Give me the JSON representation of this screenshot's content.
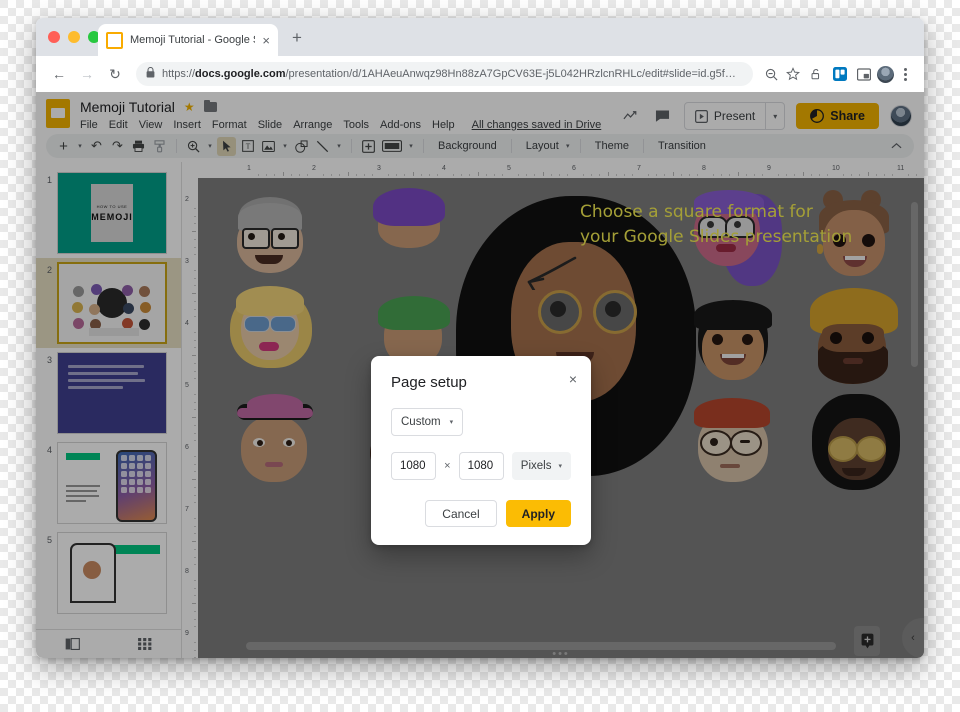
{
  "browser": {
    "tab": {
      "title": "Memoji Tutorial - Google Slides",
      "close_label": "×",
      "favicon_name": "slides-favicon"
    },
    "new_tab_label": "+",
    "nav": {
      "back": "←",
      "forward": "→",
      "reload": "↻"
    },
    "omnibox": {
      "url_scheme": "https://",
      "url_domain": "docs.google.com",
      "url_path": "/presentation/d/1AHAeuAnwqz98Hn88zA7GpCV63E-j5L042HRzlcnRHLc/edit#slide=id.g5f…",
      "lock_icon": "lock-icon",
      "zoom_out_icon": "zoom-out-icon",
      "bookmark_icon": "star-icon"
    },
    "extensions": [
      "open-lock-icon",
      "trello-icon",
      "pip-icon"
    ],
    "profile_icon": "profile-avatar",
    "menu_icon": "kebab-menu-icon"
  },
  "slides_app": {
    "doc_title": "Memoji Tutorial",
    "star_icon": "★",
    "folder_icon": "folder-icon",
    "menus": [
      "File",
      "Edit",
      "View",
      "Insert",
      "Format",
      "Slide",
      "Arrange",
      "Tools",
      "Add-ons",
      "Help"
    ],
    "save_status": "All changes saved in Drive",
    "header_actions": {
      "activity_icon": "activity-chart-icon",
      "comment_icon": "comment-icon",
      "present_label": "Present",
      "present_caret": "▾",
      "share_label": "Share",
      "share_color": "#f4b400",
      "avatar": "user-avatar"
    },
    "toolbar": {
      "new_slide_label": "+",
      "undo": "↶",
      "redo": "↷",
      "print": "print-icon",
      "paint_format": "paint-format-icon",
      "zoom": "zoom-icon",
      "select": "cursor-icon",
      "textbox": "textbox-icon",
      "image": "image-icon",
      "shape": "shape-icon",
      "line": "line-icon",
      "comment": "add-comment-icon",
      "transition_box": "video-icon",
      "background_label": "Background",
      "layout_label": "Layout",
      "theme_label": "Theme",
      "transition_label": "Transition",
      "collapse_icon": "chevron-up-icon"
    },
    "filmstrip": {
      "slides": [
        {
          "number": "1",
          "active": false,
          "title_line1": "HOW TO USE",
          "title_line2": "MEMOJI"
        },
        {
          "number": "2",
          "active": true,
          "caption": "make-your-own"
        },
        {
          "number": "3",
          "active": false,
          "body": "CREATE A MEMOJI TO MATCH YOUR PERSONALITY AND MOOD, THEN MAKE AS MANY ALTER EGOS AS YOU WANT IN MESSAGES AND FACETIME."
        },
        {
          "number": "4",
          "active": false,
          "badge": "MEMOJI ON IOS"
        },
        {
          "number": "5",
          "active": false,
          "badge": "CREATE YOUR MEMOJI"
        }
      ],
      "bottom_bar": {
        "filmstrip_view_icon": "filmstrip-view-icon",
        "grid_view_icon": "grid-view-icon"
      }
    },
    "rulers": {
      "horizontal_ticks": [
        "1",
        "2",
        "3",
        "4",
        "5",
        "6",
        "7",
        "8",
        "9",
        "10",
        "11"
      ],
      "vertical_ticks": [
        "2",
        "3",
        "4",
        "5",
        "6",
        "7",
        "8",
        "9"
      ]
    },
    "slide_canvas": {
      "background_color": "#7e7e7e",
      "annotation_line1": "Choose a square format for",
      "annotation_line2": "your Google Slides presentation",
      "annotation_color": "#f5ee52",
      "arrow_icon": "hand-drawn-arrow-icon"
    },
    "canvas_controls": {
      "speaker_notes_icon": "speaker-notes-icon",
      "collapse_panel_icon": "chevron-left-icon",
      "drag_handle_icon": "drag-dots-icon"
    }
  },
  "dialog": {
    "title": "Page setup",
    "close_label": "×",
    "preset": {
      "value": "Custom",
      "caret": "▾"
    },
    "width_value": "1080",
    "height_value": "1080",
    "multiply_symbol": "×",
    "unit": {
      "value": "Pixels",
      "caret": "▾"
    },
    "cancel_label": "Cancel",
    "apply_label": "Apply",
    "apply_color": "#fbbc04"
  }
}
